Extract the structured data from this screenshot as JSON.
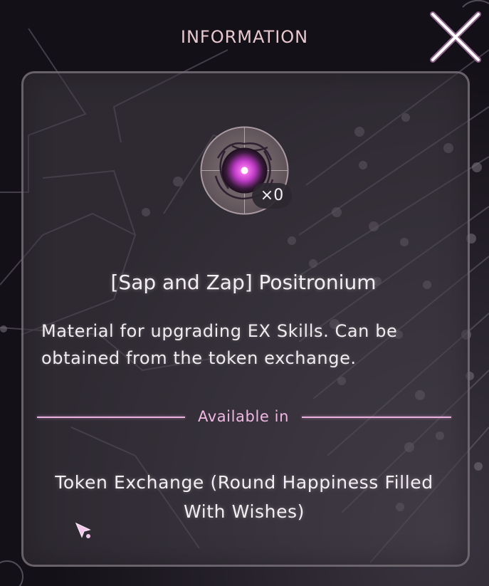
{
  "header": {
    "title": "INFORMATION"
  },
  "item": {
    "name": "[Sap and Zap] Positronium",
    "quantity": "×0",
    "description": "Material for upgrading EX Skills. Can be obtained from the token exchange.",
    "icon": "positronium-orb-icon"
  },
  "availability": {
    "label": "Available in",
    "sources": [
      "Token Exchange (Round Happiness Filled With Wishes)"
    ]
  },
  "colors": {
    "accent_pink": "#e9b2de",
    "close_glow": "#f2a6e6",
    "orb_core": "#c03cc8"
  }
}
